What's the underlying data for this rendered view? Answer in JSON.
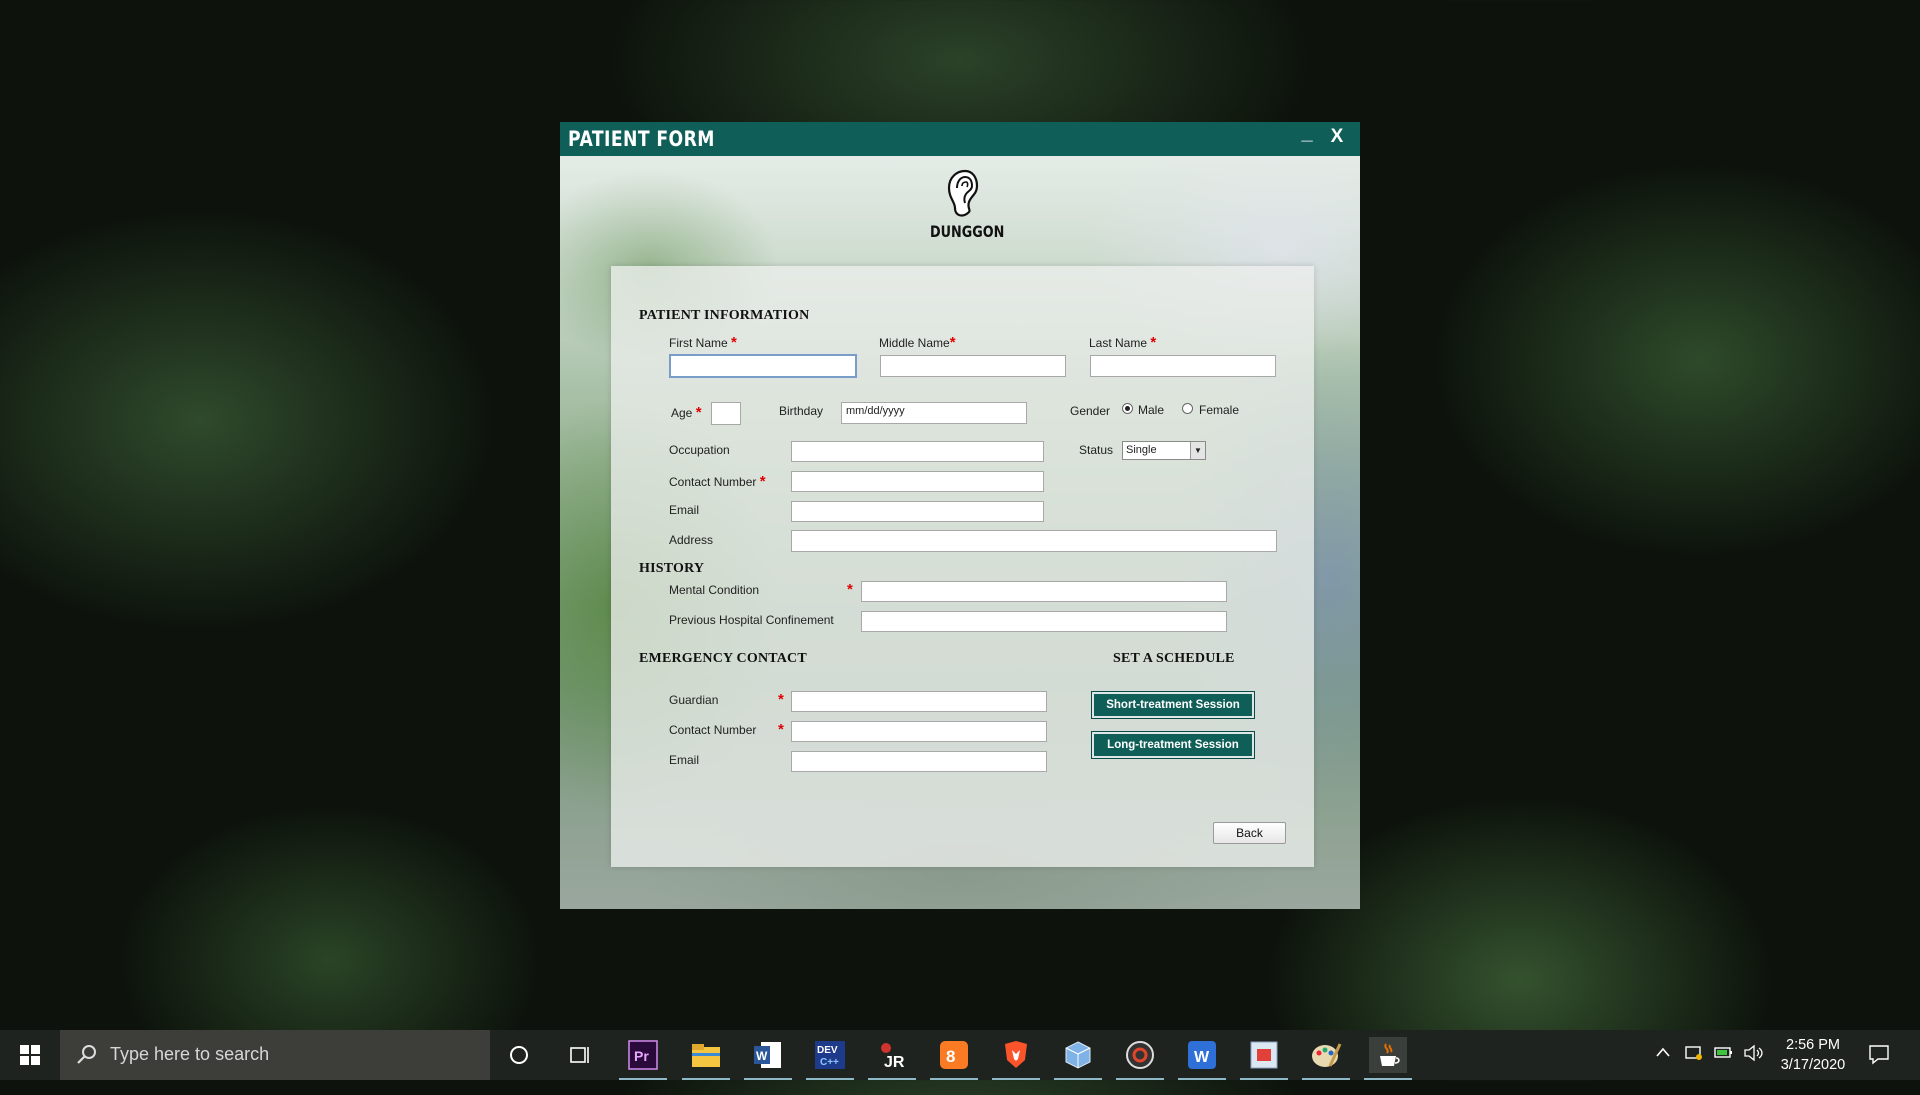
{
  "window": {
    "title": "PATIENT FORM",
    "minimize_label": "_",
    "close_label": "X",
    "brand": "DUNGGON"
  },
  "patient_info": {
    "heading": "PATIENT INFORMATION",
    "first_name_label": "First Name",
    "middle_name_label": "Middle Name",
    "last_name_label": "Last Name",
    "age_label": "Age",
    "birthday_label": "Birthday",
    "birthday_placeholder": "mm/dd/yyyy",
    "gender_label": "Gender",
    "gender_options": [
      "Male",
      "Female"
    ],
    "gender_selected": "Male",
    "occupation_label": "Occupation",
    "status_label": "Status",
    "status_value": "Single",
    "contact_label": "Contact Number",
    "email_label": "Email",
    "address_label": "Address",
    "required_mark": "*"
  },
  "history": {
    "heading": "HISTORY",
    "mental_label": "Mental Condition",
    "confinement_label": "Previous Hospital Confinement"
  },
  "emergency": {
    "heading": "EMERGENCY CONTACT",
    "guardian_label": "Guardian",
    "contact_label": "Contact Number",
    "email_label": "Email"
  },
  "schedule": {
    "heading": "SET A SCHEDULE",
    "short_label": "Short-treatment Session",
    "long_label": "Long-treatment Session"
  },
  "back_label": "Back",
  "taskbar": {
    "search_placeholder": "Type here to search",
    "apps": [
      "cortana-icon",
      "task-view-icon",
      "premiere-icon",
      "file-explorer-icon",
      "word-icon",
      "dev-cpp-icon",
      "jr-icon",
      "xampp-icon",
      "brave-icon",
      "virtualbox-icon",
      "media-player-icon",
      "wps-icon",
      "notepad-icon",
      "paint-icon",
      "java-icon"
    ],
    "time": "2:56 PM",
    "date": "3/17/2020"
  },
  "colors": {
    "accent": "#0f5e58",
    "required": "#e00000"
  }
}
